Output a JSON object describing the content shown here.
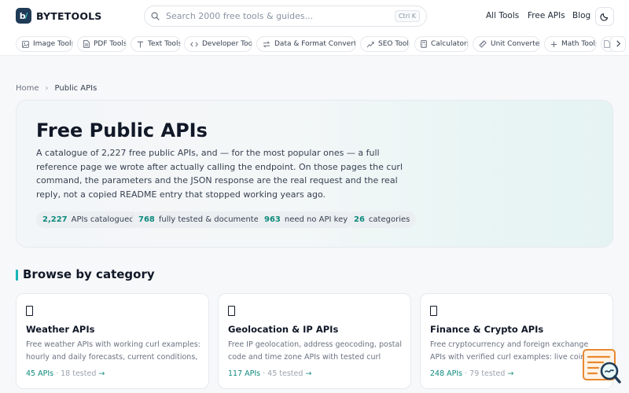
{
  "brand": {
    "name": "BYTETOOLS",
    "mark": "b",
    "mark_accent": "/"
  },
  "search": {
    "placeholder": "Search 2000 free tools & guides...",
    "shortcut": "Ctrl K"
  },
  "nav": {
    "all_tools": "All Tools",
    "free_apis": "Free APIs",
    "blog": "Blog"
  },
  "categories": [
    {
      "label": "Image Tools",
      "icon": "image-icon"
    },
    {
      "label": "PDF Tools",
      "icon": "file-icon"
    },
    {
      "label": "Text Tools",
      "icon": "text-icon"
    },
    {
      "label": "Developer Tools",
      "icon": "code-icon"
    },
    {
      "label": "Data & Format Converters",
      "icon": "convert-icon"
    },
    {
      "label": "SEO Tools",
      "icon": "chart-icon"
    },
    {
      "label": "Calculators",
      "icon": "calculator-icon"
    },
    {
      "label": "Unit Converters",
      "icon": "ruler-icon"
    },
    {
      "label": "Math Tools",
      "icon": "plus-icon"
    }
  ],
  "breadcrumb": {
    "home": "Home",
    "separator": "›",
    "current": "Public APIs"
  },
  "hero": {
    "title": "Free Public APIs",
    "description": "A catalogue of 2,227 free public APIs, and — for the most popular ones — a full reference page we wrote after actually calling the endpoint. On those pages the curl command, the parameters and the JSON response are the real request and the real reply, not a copied README entry that stopped working years ago.",
    "stats": [
      {
        "value": "2,227",
        "label": "APIs catalogued"
      },
      {
        "value": "768",
        "label": "fully tested & documented"
      },
      {
        "value": "963",
        "label": "need no API key"
      },
      {
        "value": "26",
        "label": "categories"
      }
    ]
  },
  "browse": {
    "title": "Browse by category",
    "cards": [
      {
        "title": "Weather APIs",
        "description": "Free weather APIs with working curl examples: hourly and daily forecasts, current conditions, air quality and more.",
        "count": "45 APIs",
        "tested": "18 tested",
        "arrow": "→"
      },
      {
        "title": "Geolocation & IP APIs",
        "description": "Free IP geolocation, address geocoding, postal code and time zone APIs with tested curl examples.",
        "count": "117 APIs",
        "tested": "45 tested",
        "arrow": "→"
      },
      {
        "title": "Finance & Crypto APIs",
        "description": "Free cryptocurrency and foreign exchange APIs with verified curl examples: live coin prices, exchange rates and more.",
        "count": "248 APIs",
        "tested": "79 tested",
        "arrow": "→"
      }
    ]
  },
  "colors": {
    "accent": "#0e8a7c",
    "brand_dark": "#1f3b57",
    "teal": "#17b5b5",
    "widget_orange": "#e8892f"
  }
}
